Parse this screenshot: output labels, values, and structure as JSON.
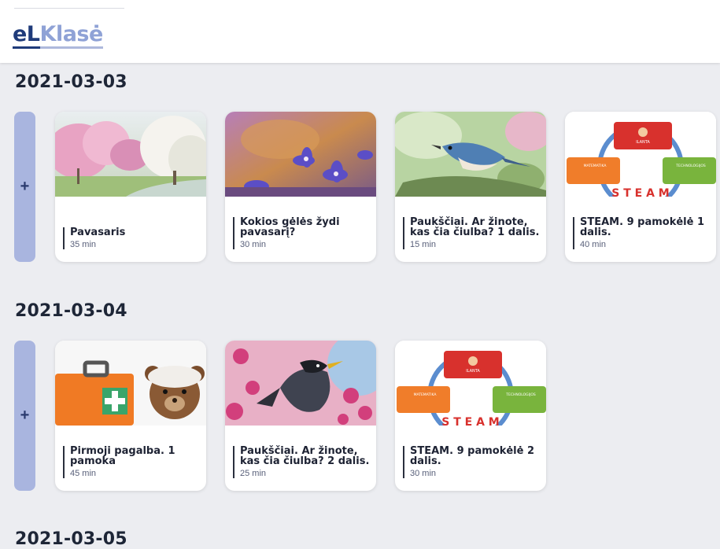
{
  "header": {
    "logo_part1": "eL",
    "logo_part2": "Klasė"
  },
  "days": [
    {
      "date": "2021-03-03",
      "add_label": "+",
      "cards": [
        {
          "title": "Pavasaris",
          "duration": "35 min",
          "image": "spring-blossom-trees"
        },
        {
          "title": "Kokios gėlės žydi pavasarį?",
          "duration": "30 min",
          "image": "purple-spring-flowers"
        },
        {
          "title": "Paukščiai. Ar žinote, kas čia čiulba? 1 dalis.",
          "duration": "15 min",
          "image": "blue-nuthatch-bird"
        },
        {
          "title": "STEAM. 9 pamokėlė 1 dalis.",
          "duration": "40 min",
          "image": "steam-cycle-diagram"
        }
      ]
    },
    {
      "date": "2021-03-04",
      "add_label": "+",
      "cards": [
        {
          "title": "Pirmoji pagalba. 1 pamoka",
          "duration": "45 min",
          "image": "teddy-bear-first-aid"
        },
        {
          "title": "Paukščiai. Ar žinote, kas čia čiulba? 2 dalis.",
          "duration": "25 min",
          "image": "bird-on-pink-blossoms"
        },
        {
          "title": "STEAM. 9 pamokėlė 2 dalis.",
          "duration": "30 min",
          "image": "steam-cycle-diagram"
        }
      ]
    },
    {
      "date": "2021-03-05"
    }
  ],
  "steam_diagram": {
    "box_top": "ILANTA",
    "box_left": "MATEMATIKA",
    "box_right": "TECHNOLOGIJOS"
  }
}
